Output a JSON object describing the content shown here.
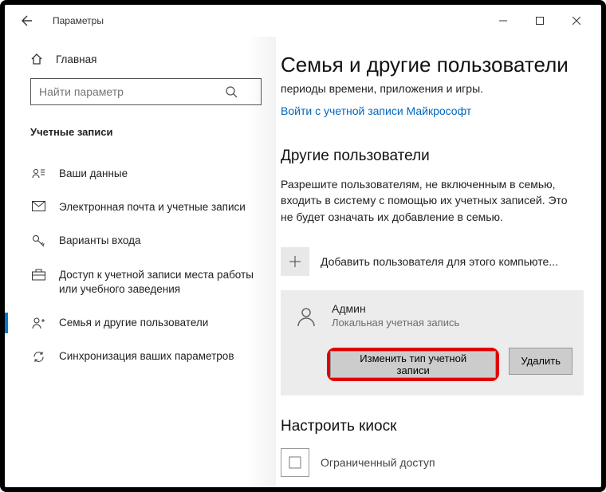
{
  "window": {
    "title": "Параметры"
  },
  "sidebar": {
    "home": "Главная",
    "search_placeholder": "Найти параметр",
    "section": "Учетные записи",
    "items": [
      {
        "label": "Ваши данные"
      },
      {
        "label": "Электронная почта и учетные записи"
      },
      {
        "label": "Варианты входа"
      },
      {
        "label": "Доступ к учетной записи места работы или учебного заведения"
      },
      {
        "label": "Семья и другие пользователи"
      },
      {
        "label": "Синхронизация ваших параметров"
      }
    ]
  },
  "main": {
    "title": "Семья и другие пользователи",
    "subtitle": "периоды времени, приложения и игры.",
    "signin_link": "Войти с учетной записи Майкрософт",
    "other_users_heading": "Другие пользователи",
    "other_users_desc": "Разрешите пользователям, не включенным в семью, входить в систему с помощью их учетных записей. Это не будет означать их добавление в семью.",
    "add_user": "Добавить пользователя для этого компьюте...",
    "user": {
      "name": "Админ",
      "type": "Локальная учетная запись",
      "change_type_btn": "Изменить тип учетной записи",
      "delete_btn": "Удалить"
    },
    "kiosk_heading": "Настроить киоск",
    "kiosk_item": "Ограниченный доступ"
  }
}
